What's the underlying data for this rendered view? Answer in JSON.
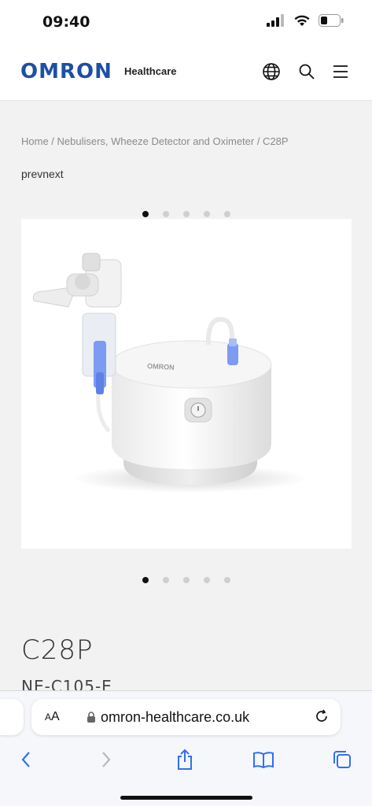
{
  "status": {
    "time": "09:40"
  },
  "header": {
    "logo": "OMRON",
    "logo_sub": "Healthcare"
  },
  "breadcrumb": "Home / Nebulisers, Wheeze Detector and Oximeter / C28P",
  "gallery": {
    "prevnext": "prevnext",
    "dot_count": 5,
    "active_index": 0,
    "device_brand": "OMRON"
  },
  "product": {
    "title": "C28P",
    "model": "NE-C105-E"
  },
  "browser": {
    "aa_label": "AA",
    "url": "omron-healthcare.co.uk"
  },
  "colors": {
    "brand": "#1d4fa5",
    "accent_blue": "#7d9bf0"
  }
}
